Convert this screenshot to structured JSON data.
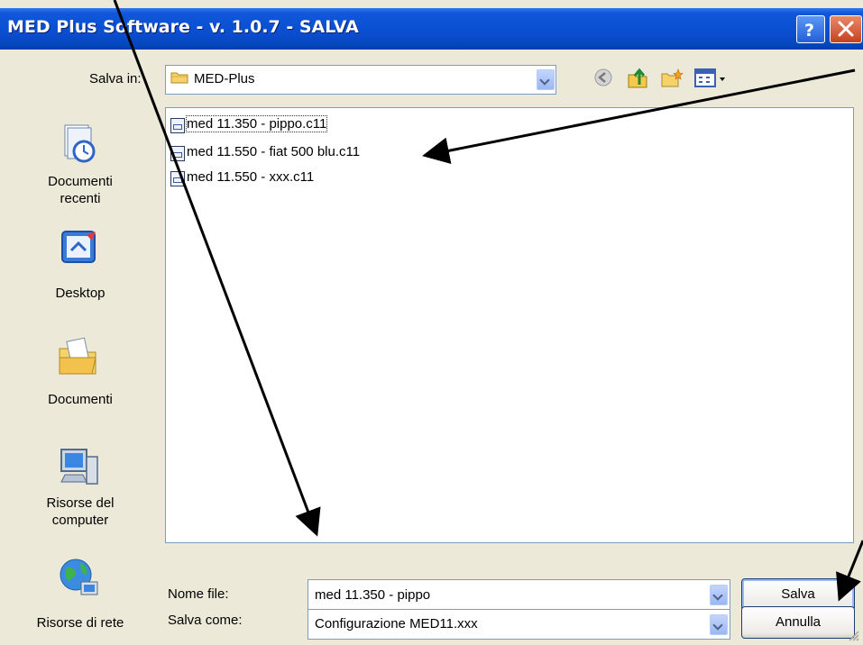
{
  "window": {
    "title": "MED Plus Software - v. 1.0.7 - SALVA"
  },
  "toolbar": {
    "save_in_label": "Salva in:",
    "location_value": "MED-Plus",
    "icons": [
      "back-icon",
      "up-folder-icon",
      "new-folder-icon",
      "view-menu-icon"
    ]
  },
  "places": [
    {
      "label": "Documenti recenti",
      "icon": "recent-documents-icon"
    },
    {
      "label": "Desktop",
      "icon": "desktop-icon"
    },
    {
      "label": "Documenti",
      "icon": "documents-folder-icon"
    },
    {
      "label": "Risorse del computer",
      "icon": "my-computer-icon"
    },
    {
      "label": "Risorse di rete",
      "icon": "network-icon"
    }
  ],
  "files": [
    {
      "name": "med 11.350 - pippo.c11"
    },
    {
      "name": "med 11.550 - fiat 500 blu.c11"
    },
    {
      "name": "med 11.550 - xxx.c11"
    }
  ],
  "form": {
    "filename_label": "Nome file:",
    "filename_value": "med 11.350 - pippo",
    "filetype_label": "Salva come:",
    "filetype_value": "Configurazione MED11.xxx"
  },
  "buttons": {
    "save": "Salva",
    "cancel": "Annulla"
  },
  "colors": {
    "titlebar": "#0a4fd2",
    "dialog_bg": "#ece9d8",
    "annotation_arrows": "#000000"
  }
}
